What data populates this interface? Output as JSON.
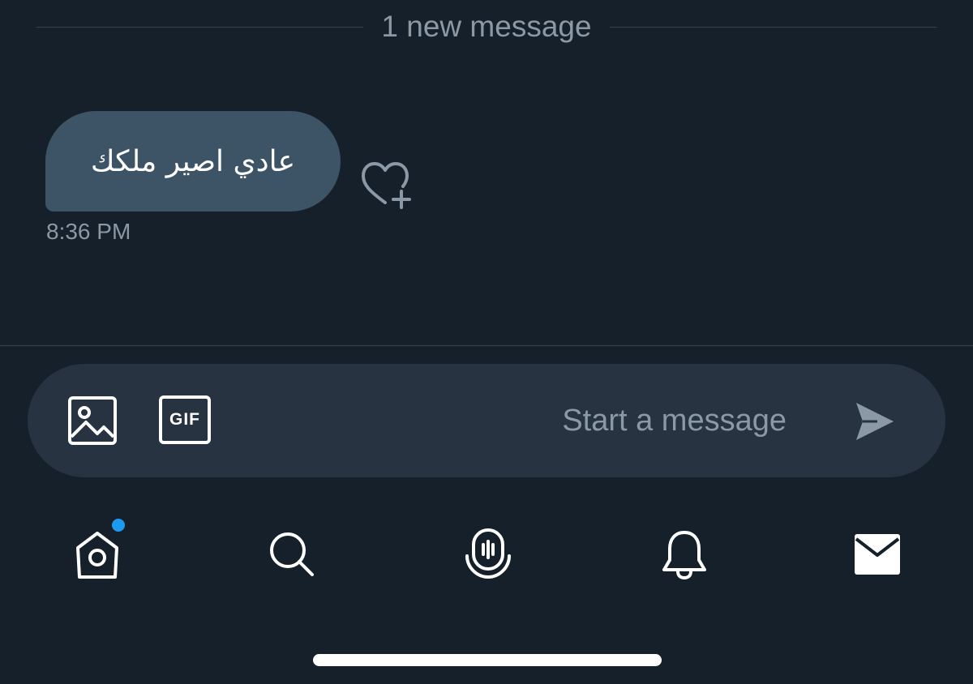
{
  "divider": {
    "label": "1 new message"
  },
  "message": {
    "text": "عادي اصير ملكك",
    "time": "8:36 PM",
    "react_icon": "heart-plus-icon"
  },
  "composer": {
    "placeholder": "Start a message",
    "media_icon": "image-icon",
    "gif_label": "GIF",
    "send_icon": "send-icon"
  },
  "tabbar": {
    "items": [
      {
        "id": "home",
        "icon": "home-icon",
        "has_badge": true
      },
      {
        "id": "search",
        "icon": "search-icon"
      },
      {
        "id": "spaces",
        "icon": "spaces-icon"
      },
      {
        "id": "notifications",
        "icon": "bell-icon"
      },
      {
        "id": "messages",
        "icon": "mail-icon",
        "active": true
      }
    ]
  },
  "colors": {
    "background": "#15202b",
    "bubble": "#3d5466",
    "composer": "#273340",
    "muted_text": "#8b98a5",
    "accent": "#1d9bf0"
  }
}
